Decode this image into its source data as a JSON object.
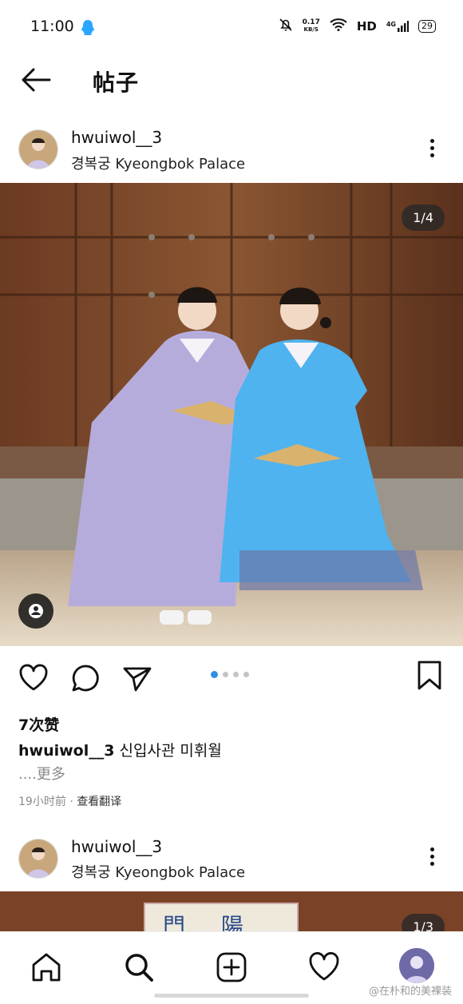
{
  "status_bar": {
    "time": "11:00",
    "net_speed_value": "0.17",
    "net_speed_unit": "KB/S",
    "hd": "HD",
    "signal": "4G",
    "battery": "29"
  },
  "header": {
    "title": "帖子"
  },
  "post1": {
    "username": "hwuiwol__3",
    "location": "경복궁 Kyeongbok Palace",
    "counter": "1/4",
    "likes": "7次赞",
    "caption_user": "hwuiwol__3",
    "caption_text": "신입사관 미휘월",
    "more": "....更多",
    "time_ago": "19小时前",
    "translate": "查看翻译",
    "carousel": {
      "total": 4,
      "active": 0
    }
  },
  "post2": {
    "username": "hwuiwol__3",
    "location": "경복궁 Kyeongbok Palace",
    "counter": "1/3",
    "sign_text": "門 陽 初"
  },
  "watermark": "@在朴和的美裸装",
  "colors": {
    "accent": "#2f8fe3",
    "qq": "#2aa6ff"
  },
  "icons": [
    "back-arrow-icon",
    "more-vertical-icon",
    "heart-icon",
    "comment-icon",
    "send-icon",
    "bookmark-icon",
    "home-icon",
    "search-icon",
    "add-icon",
    "activity-heart-icon",
    "profile-avatar"
  ]
}
